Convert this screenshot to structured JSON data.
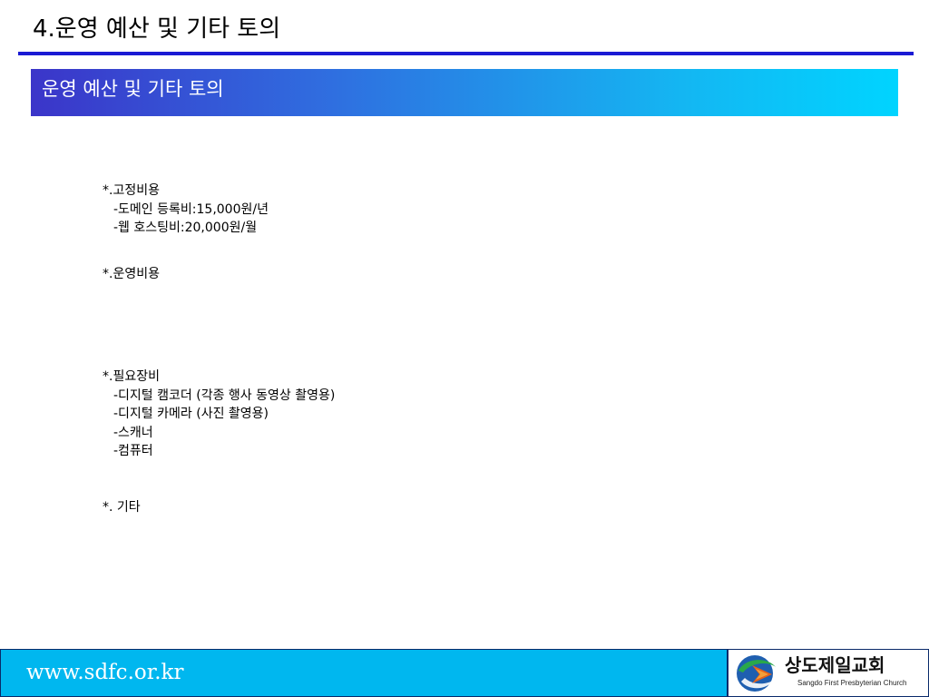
{
  "slide": {
    "title": "4.운영 예산 및 기타 토의",
    "banner": "운영 예산 및 기타 토의"
  },
  "content": {
    "groups": [
      {
        "heading": "*.고정비용",
        "items": [
          "-도메인 등록비:15,000원/년",
          "-웹 호스팅비:20,000원/월"
        ]
      },
      {
        "heading": "*.운영비용",
        "items": []
      },
      {
        "heading": "*.필요장비",
        "items": [
          "-디지털 캠코더 (각종 행사 동영상 촬영용)",
          "-디지털 카메라 (사진 촬영용)",
          "-스캐너",
          "-컴퓨터"
        ]
      },
      {
        "heading": "*. 기타",
        "items": []
      }
    ]
  },
  "footer": {
    "url": "www.sdfc.or.kr",
    "church_name": "상도제일교회",
    "church_name_en": "Sangdo First Presbyterian Church"
  },
  "colors": {
    "title_rule": "#1a1ad4",
    "banner_start": "#3b35c9",
    "banner_end": "#00d4ff",
    "footer_bg": "#00b7ef"
  }
}
